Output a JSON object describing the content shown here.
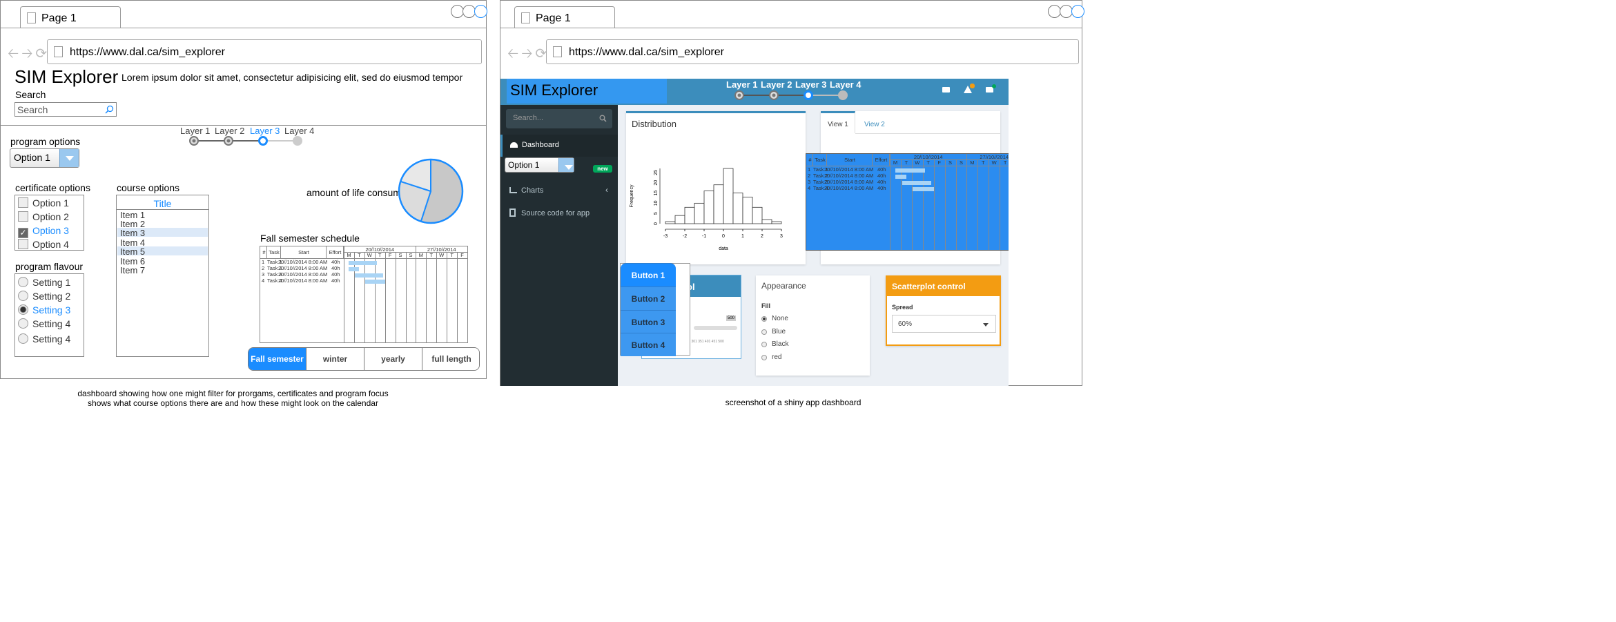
{
  "left": {
    "tab_title": "Page 1",
    "url": "https://www.dal.ca/sim_explorer",
    "app_title": "SIM Explorer",
    "tagline": "Lorem ipsum dolor sit amet, consectetur adipisicing elit, sed do eiusmod tempor",
    "search_label": "Search",
    "search_placeholder": "Search",
    "program_options_label": "program options",
    "program_option_selected": "Option 1",
    "layers": [
      {
        "label": "Layer 1",
        "state": "done"
      },
      {
        "label": "Layer 2",
        "state": "done"
      },
      {
        "label": "Layer 3",
        "state": "current"
      },
      {
        "label": "Layer 4",
        "state": "off"
      }
    ],
    "certificate_options_label": "certificate options",
    "certificate_options": [
      {
        "label": "Option 1",
        "checked": false
      },
      {
        "label": "Option 2",
        "checked": false
      },
      {
        "label": "Option 3",
        "checked": true
      },
      {
        "label": "Option 4",
        "checked": false
      }
    ],
    "course_options_label": "course options",
    "course_list_title": "Title",
    "course_items": [
      "Item 1",
      "Item 2",
      "Item 3",
      "Item 4",
      "Item 5",
      "Item 6",
      "Item 7"
    ],
    "course_items_highlighted": [
      "Item 3",
      "Item 5"
    ],
    "program_flavour_label": "program flavour",
    "program_flavours": [
      {
        "label": "Setting 1",
        "selected": false
      },
      {
        "label": "Setting 2",
        "selected": false
      },
      {
        "label": "Setting 3",
        "selected": true
      },
      {
        "label": "Setting 4",
        "selected": false
      },
      {
        "label": "Setting 4",
        "selected": false
      }
    ],
    "pie_label": "amount of life consumed",
    "pie_slices": [
      0.55,
      0.25,
      0.2
    ],
    "schedule_label": "Fall semester schedule",
    "gantt": {
      "headers": [
        "#",
        "Task",
        "Start",
        "Effort"
      ],
      "weeks": [
        "20//10//2014",
        "27//10//2014"
      ],
      "days": [
        "M",
        "T",
        "W",
        "T",
        "F",
        "S",
        "S",
        "M",
        "T",
        "W",
        "T",
        "F"
      ],
      "rows": [
        {
          "n": "1",
          "task": "Task 1",
          "start": "20//10//2014 8:00 AM",
          "effort": "40h"
        },
        {
          "n": "2",
          "task": "Task 2",
          "start": "20//10//2014 8:00 AM",
          "effort": "40h"
        },
        {
          "n": "3",
          "task": "Task 3",
          "start": "20//10//2014 8:00 AM",
          "effort": "40h"
        },
        {
          "n": "4",
          "task": "Task 4",
          "start": "20//10//2014 8:00 AM",
          "effort": "40h"
        }
      ]
    },
    "period_buttons": [
      {
        "label": "Fall semester",
        "active": true
      },
      {
        "label": "winter",
        "active": false
      },
      {
        "label": "yearly",
        "active": false
      },
      {
        "label": "full length",
        "active": false
      }
    ],
    "caption_line1": "dashboard showing how one might filter for prorgams, certificates and program focus",
    "caption_line2": "shows what course options there are and how these might look on the calendar"
  },
  "right": {
    "tab_title": "Page 1",
    "url": "https://www.dal.ca/sim_explorer",
    "app_title": "SIM Explorer",
    "layers": [
      "Layer 1",
      "Layer 2",
      "Layer 3",
      "Layer 4"
    ],
    "search_placeholder": "Search...",
    "sidebar": [
      {
        "label": "Dashboard",
        "icon": "dashboard-icon"
      },
      {
        "label": "Charts",
        "icon": "bar-chart-icon"
      },
      {
        "label": "Source code for app",
        "icon": "file-icon"
      }
    ],
    "select_value": "Option 1",
    "new_badge": "new",
    "distribution_title": "Distribution",
    "histogram": {
      "ylabel": "Frequency",
      "xlabel": "data",
      "xticks": [
        "-3",
        "-2",
        "-1",
        "0",
        "1",
        "2",
        "3"
      ],
      "yticks": [
        "0",
        "5",
        "10",
        "15",
        "20",
        "25"
      ]
    },
    "view_tabs": [
      "View 1",
      "View 2"
    ],
    "menu_buttons": [
      "Button 1",
      "Button 2",
      "Button 3",
      "Button 4"
    ],
    "partial_box_title": "rol",
    "slider_value": "500",
    "slider_ticks": "201 251 301 351 401 451 500",
    "appearance_title": "Appearance",
    "fill_label": "Fill",
    "fill_options": [
      "None",
      "Blue",
      "Black",
      "red"
    ],
    "scatter_title": "Scatterplot control",
    "spread_label": "Spread",
    "spread_value": "60%",
    "caption": "screenshot of a shiny app dashboard"
  }
}
